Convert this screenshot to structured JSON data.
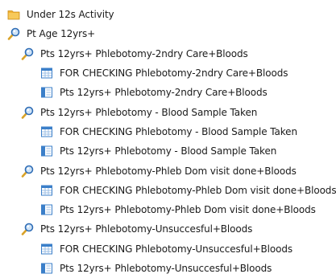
{
  "tree": {
    "items": [
      {
        "label": "Under 12s Activity",
        "icon": "folder-icon",
        "level": 0
      },
      {
        "label": "Pt Age 12yrs+",
        "icon": "search-icon",
        "level": 0
      },
      {
        "label": "Pts 12yrs+ Phlebotomy-2ndry Care+Bloods",
        "icon": "search-icon",
        "level": 1
      },
      {
        "label": "FOR CHECKING Phlebotomy-2ndry Care+Bloods",
        "icon": "report-table-icon",
        "level": 2
      },
      {
        "label": "Pts 12yrs+ Phlebotomy-2ndry Care+Bloods",
        "icon": "report-list-icon",
        "level": 2
      },
      {
        "label": "Pts 12yrs+ Phlebotomy - Blood Sample Taken",
        "icon": "search-icon",
        "level": 1
      },
      {
        "label": "FOR CHECKING Phlebotomy - Blood Sample Taken",
        "icon": "report-table-icon",
        "level": 2
      },
      {
        "label": "Pts 12yrs+ Phlebotomy - Blood Sample Taken",
        "icon": "report-list-icon",
        "level": 2
      },
      {
        "label": "Pts 12yrs+ Phlebotomy-Phleb Dom visit done+Bloods",
        "icon": "search-icon",
        "level": 1
      },
      {
        "label": "FOR CHECKING Phlebotomy-Phleb Dom visit done+Bloods",
        "icon": "report-table-icon",
        "level": 2
      },
      {
        "label": "Pts 12yrs+ Phlebotomy-Phleb Dom visit done+Bloods",
        "icon": "report-list-icon",
        "level": 2
      },
      {
        "label": "Pts 12yrs+ Phlebotomy-Unsuccesful+Bloods",
        "icon": "search-icon",
        "level": 1
      },
      {
        "label": "FOR CHECKING Phlebotomy-Unsuccesful+Bloods",
        "icon": "report-table-icon",
        "level": 2
      },
      {
        "label": "Pts 12yrs+ Phlebotomy-Unsuccesful+Bloods",
        "icon": "report-list-icon",
        "level": 2
      }
    ]
  },
  "colors": {
    "folder": "#f2b233",
    "search_lens": "#2f6db5",
    "search_handle": "#d9a227",
    "report_blue": "#3b7fc9"
  }
}
